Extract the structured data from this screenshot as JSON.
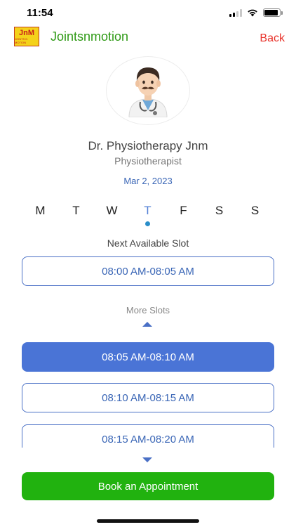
{
  "status_bar": {
    "time": "11:54",
    "battery_level": 0.9
  },
  "header": {
    "logo_text": "JnM",
    "logo_subtext": "JOINTS N MOTION",
    "title": "Jointsnmotion",
    "back_label": "Back"
  },
  "doctor": {
    "name": "Dr. Physiotherapy Jnm",
    "role": "Physiotherapist",
    "avatar_icon": "doctor-emoji-icon"
  },
  "date": "Mar 2, 2023",
  "weekdays": [
    {
      "label": "M",
      "selected": false
    },
    {
      "label": "T",
      "selected": false
    },
    {
      "label": "W",
      "selected": false
    },
    {
      "label": "T",
      "selected": true
    },
    {
      "label": "F",
      "selected": false
    },
    {
      "label": "S",
      "selected": false
    },
    {
      "label": "S",
      "selected": false
    }
  ],
  "next_slot": {
    "label": "Next Available Slot",
    "time": "08:00 AM-08:05 AM"
  },
  "more_slots": {
    "label": "More Slots",
    "slots": [
      {
        "time": "08:05 AM-08:10 AM",
        "selected": true
      },
      {
        "time": "08:10 AM-08:15 AM",
        "selected": false
      },
      {
        "time": "08:15 AM-08:20 AM",
        "selected": false
      }
    ]
  },
  "book_button_label": "Book an Appointment",
  "colors": {
    "brand_green": "#21b20f",
    "title_green": "#2f9a16",
    "back_red": "#e8332b",
    "accent_blue": "#4a74d6"
  }
}
